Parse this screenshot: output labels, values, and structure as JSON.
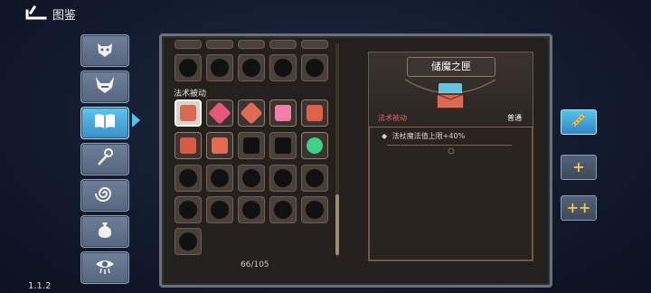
{
  "header": {
    "title": "图鉴",
    "back_icon": "back-arrow-icon"
  },
  "categories": [
    {
      "icon": "demon-mask-icon",
      "active": false
    },
    {
      "icon": "horned-monster-icon",
      "active": false
    },
    {
      "icon": "book-icon",
      "active": true
    },
    {
      "icon": "staff-icon",
      "active": false
    },
    {
      "icon": "spiral-icon",
      "active": false
    },
    {
      "icon": "pouch-icon",
      "active": false
    },
    {
      "icon": "eye-icon",
      "active": false
    }
  ],
  "grid": {
    "section_label": "法术被动",
    "count_text": "66/105"
  },
  "detail": {
    "name": "储魔之匣",
    "type": "法术被动",
    "rarity": "普通",
    "effect": "法杖魔法值上限+40%",
    "icon": "treasure-box-icon"
  },
  "right_buttons": [
    {
      "icon": "wand-icon",
      "active": true
    },
    {
      "icon": "single-plus-icon",
      "active": false
    },
    {
      "icon": "double-plus-icon",
      "active": false
    }
  ],
  "version": "1.1.2",
  "colors": {
    "accent_blue": "#5bbfee",
    "type_red": "#ea5d5d",
    "gold": "#f4c43a"
  }
}
